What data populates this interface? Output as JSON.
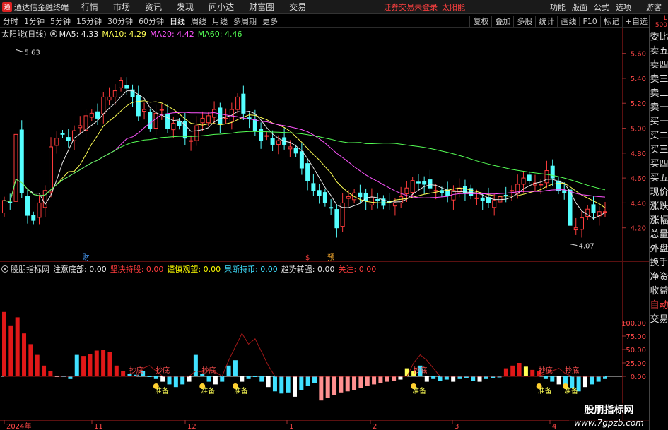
{
  "app": {
    "title": "通达信金融终端"
  },
  "menu": {
    "items": [
      "行情",
      "市场",
      "资讯",
      "发现",
      "问小达",
      "财富圈",
      "交易"
    ],
    "alert": "证券交易未登录",
    "stock_name": "太阳能",
    "right_items": [
      "功能",
      "版面",
      "公式",
      "选项",
      "游客"
    ]
  },
  "toolbar": {
    "tabs": [
      "分时",
      "1分钟",
      "5分钟",
      "15分钟",
      "30分钟",
      "60分钟",
      "日线",
      "周线",
      "月线",
      "多周期",
      "更多"
    ],
    "active_tab": "日线",
    "right_buttons": [
      "复权",
      "叠加",
      "多股",
      "统计",
      "画线",
      "F10",
      "标记",
      "+自选"
    ]
  },
  "sidebar": {
    "badge": "L 500",
    "items": [
      "委比",
      "卖五",
      "卖四",
      "卖三",
      "卖二",
      "卖一",
      "买一",
      "买二",
      "买三",
      "买四",
      "买五",
      "现价",
      "涨跌",
      "涨幅",
      "总量",
      "外盘",
      "换手",
      "净资",
      "收益",
      "自动",
      "交易"
    ]
  },
  "legend_main": {
    "title": "太阳能(日线)",
    "ma5": "MA5: 4.33",
    "ma10": "MA10: 4.29",
    "ma20": "MA20: 4.42",
    "ma60": "MA60: 4.46"
  },
  "legend_indicator": {
    "title": "股朋指标网",
    "items": [
      {
        "text": "注意底部: 0.00",
        "color": "#e8e8e8"
      },
      {
        "text": "坚决持股: 0.00",
        "color": "#ff3c3c"
      },
      {
        "text": "谨慎观望: 0.00",
        "color": "#ffff00"
      },
      {
        "text": "果断持币: 0.00",
        "color": "#40e0ff"
      },
      {
        "text": "趋势转强: 0.00",
        "color": "#e8e8e8"
      },
      {
        "text": "关注: 0.00",
        "color": "#ff3c3c"
      }
    ]
  },
  "colors": {
    "up": "#ff3c3c",
    "down": "#54ffff",
    "ma5": "#e8e8e8",
    "ma10": "#ffff55",
    "ma20": "#ff55ff",
    "ma60": "#55ff55",
    "grid": "#5a1010"
  },
  "watermark": {
    "line1": "股朋指标网",
    "line2": "www.7gpzb.com"
  },
  "chart_data": [
    {
      "type": "candlestick",
      "title": "太阳能(日线)",
      "y_ticks": [
        4.2,
        4.4,
        4.6,
        4.8,
        5.0,
        5.2,
        5.4,
        5.6
      ],
      "ylim": [
        4.0,
        5.7
      ],
      "annotations": {
        "high": "5.63",
        "low": "4.07",
        "events": [
          "财",
          "$",
          "预"
        ]
      },
      "ma_values": {
        "MA5": 4.33,
        "MA10": 4.29,
        "MA20": 4.42,
        "MA60": 4.46
      },
      "closes": [
        4.42,
        4.4,
        4.95,
        4.48,
        4.3,
        4.26,
        4.4,
        4.5,
        4.85,
        4.92,
        4.95,
        4.9,
        4.98,
        5.02,
        5.1,
        5.12,
        5.08,
        5.25,
        5.25,
        5.3,
        5.38,
        5.32,
        5.25,
        5.1,
        5.15,
        5.0,
        5.12,
        5.15,
        5.0,
        5.04,
        5.02,
        4.92,
        4.9,
        5.02,
        5.08,
        5.1,
        5.15,
        5.04,
        5.08,
        5.15,
        5.25,
        5.12,
        5.08,
        4.98,
        4.9,
        4.94,
        4.87,
        4.9,
        4.87,
        4.85,
        4.8,
        4.68,
        4.58,
        4.5,
        4.46,
        4.4,
        4.36,
        4.2,
        4.4,
        4.45,
        4.48,
        4.45,
        4.42,
        4.44,
        4.42,
        4.38,
        4.4,
        4.4,
        4.45,
        4.52,
        4.58,
        4.56,
        4.55,
        4.52,
        4.5,
        4.48,
        4.46,
        4.5,
        4.52,
        4.48,
        4.46,
        4.44,
        4.42,
        4.4,
        4.42,
        4.45,
        4.46,
        4.5,
        4.55,
        4.6,
        4.58,
        4.56,
        4.55,
        4.66,
        4.6,
        4.5,
        4.48,
        4.22,
        4.2,
        4.28,
        4.35,
        4.32,
        4.33,
        4.33
      ]
    },
    {
      "type": "bar",
      "title": "股朋指标网",
      "y_ticks": [
        0.0,
        25.0,
        50.0,
        75.0,
        100.0
      ],
      "x_ticks": [
        "2024年",
        "11",
        "12",
        "1",
        "2",
        "3",
        "4"
      ],
      "series": [
        {
          "name": "注意底部",
          "color": "#e8e8e8"
        },
        {
          "name": "坚决持股",
          "color": "#ff3c3c"
        },
        {
          "name": "谨慎观望",
          "color": "#ffff00"
        },
        {
          "name": "果断持币",
          "color": "#40e0ff"
        },
        {
          "name": "趋势转强",
          "color": "#e8e8e8"
        },
        {
          "name": "关注",
          "color": "#ff3c3c"
        }
      ],
      "labels": [
        "抄底",
        "准备"
      ],
      "bar_values": [
        120,
        95,
        110,
        80,
        60,
        40,
        20,
        10,
        0,
        0,
        -5,
        40,
        38,
        42,
        48,
        50,
        45,
        20,
        10,
        5,
        3,
        10,
        0,
        -5,
        -10,
        -15,
        -20,
        -15,
        -10,
        40,
        5,
        -10,
        -15,
        -10,
        20,
        30,
        -10,
        -5,
        0,
        -10,
        -20,
        -28,
        -32,
        -30,
        -38,
        -25,
        -18,
        -12,
        -45,
        -40,
        -35,
        -30,
        -28,
        -25,
        -22,
        -18,
        -15,
        -12,
        -10,
        -8,
        -6,
        15,
        10,
        20,
        -10,
        -5,
        -8,
        -6,
        -10,
        -5,
        -3,
        -8,
        -10,
        -5,
        -3,
        -2,
        15,
        20,
        25,
        18,
        12,
        10,
        -5,
        -10,
        -15,
        -18,
        -22,
        -28,
        -20,
        -15,
        -10,
        -5
      ],
      "line_values": [
        0,
        0,
        0,
        0,
        0,
        0,
        0,
        0,
        0,
        0,
        0,
        0,
        0,
        0,
        0,
        0,
        0,
        0,
        0,
        0,
        0,
        15,
        20,
        10,
        0,
        0,
        0,
        0,
        0,
        10,
        8,
        12,
        8,
        0,
        30,
        55,
        80,
        60,
        70,
        45,
        20,
        0,
        0,
        0,
        0,
        0,
        0,
        0,
        0,
        0,
        0,
        0,
        0,
        0,
        0,
        0,
        0,
        0,
        0,
        0,
        0,
        0,
        25,
        40,
        30,
        15,
        0,
        0,
        0,
        0,
        0,
        0,
        0,
        0,
        0,
        0,
        0,
        0,
        0,
        0,
        0,
        0,
        5,
        10,
        15,
        5,
        0,
        0,
        0,
        0,
        0,
        0
      ]
    }
  ]
}
